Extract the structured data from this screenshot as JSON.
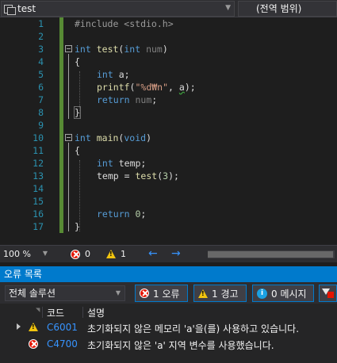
{
  "navbar": {
    "scope_label": "test",
    "member_label": "(전역 범위)"
  },
  "editor": {
    "lines": [
      {
        "n": "1"
      },
      {
        "n": "2"
      },
      {
        "n": "3"
      },
      {
        "n": "4"
      },
      {
        "n": "5"
      },
      {
        "n": "6"
      },
      {
        "n": "7"
      },
      {
        "n": "8"
      },
      {
        "n": "9"
      },
      {
        "n": "10"
      },
      {
        "n": "11"
      },
      {
        "n": "12"
      },
      {
        "n": "13"
      },
      {
        "n": "14"
      },
      {
        "n": "15"
      },
      {
        "n": "16"
      },
      {
        "n": "17"
      }
    ],
    "code": {
      "l1_pp": "#include <stdio.h>",
      "l3_kw1": "int",
      "l3_fn": "test",
      "l3_kw2": "int",
      "l3_param": "num",
      "brace_open": "{",
      "brace_close": "}",
      "l5_kw": "int",
      "l5_var": "a",
      "l6_fn": "printf",
      "l6_str": "\"%d₩n\"",
      "l6_arg": "a",
      "l7_kw": "return",
      "l7_var": "num",
      "l10_kw1": "int",
      "l10_fn": "main",
      "l10_kw2": "void",
      "l12_kw": "int",
      "l12_var": "temp",
      "l13_var": "temp",
      "l13_fn": "test",
      "l13_num": "3",
      "l16_kw": "return",
      "l16_num": "0"
    }
  },
  "status": {
    "zoom": "100 %",
    "error_count": "0",
    "warning_count": "1"
  },
  "error_list": {
    "title": "오류 목록",
    "scope": "전체 솔루션",
    "errors_label": "1 오류",
    "warnings_label": "1 경고",
    "messages_label": "0 메시지",
    "col_code": "코드",
    "col_desc": "설명",
    "rows": [
      {
        "severity": "warning",
        "code": "C6001",
        "description": "초기화되지 않은 메모리 'a'을(를) 사용하고 있습니다."
      },
      {
        "severity": "error",
        "code": "C4700",
        "description": "초기화되지 않은 'a' 지역 변수를 사용했습니다."
      }
    ]
  },
  "colors": {
    "accent": "#007acc",
    "change_bar": "#578a34",
    "keyword": "#569cd6",
    "string": "#d69d85",
    "line_number": "#2b91af",
    "error": "#e51400",
    "warning": "#f1c40f"
  },
  "icons": {
    "scope": "class-scope-icon",
    "error": "error-icon",
    "warning": "warning-icon",
    "info": "info-icon",
    "filter": "filter-icon",
    "prev": "arrow-left-icon",
    "next": "arrow-right-icon"
  }
}
